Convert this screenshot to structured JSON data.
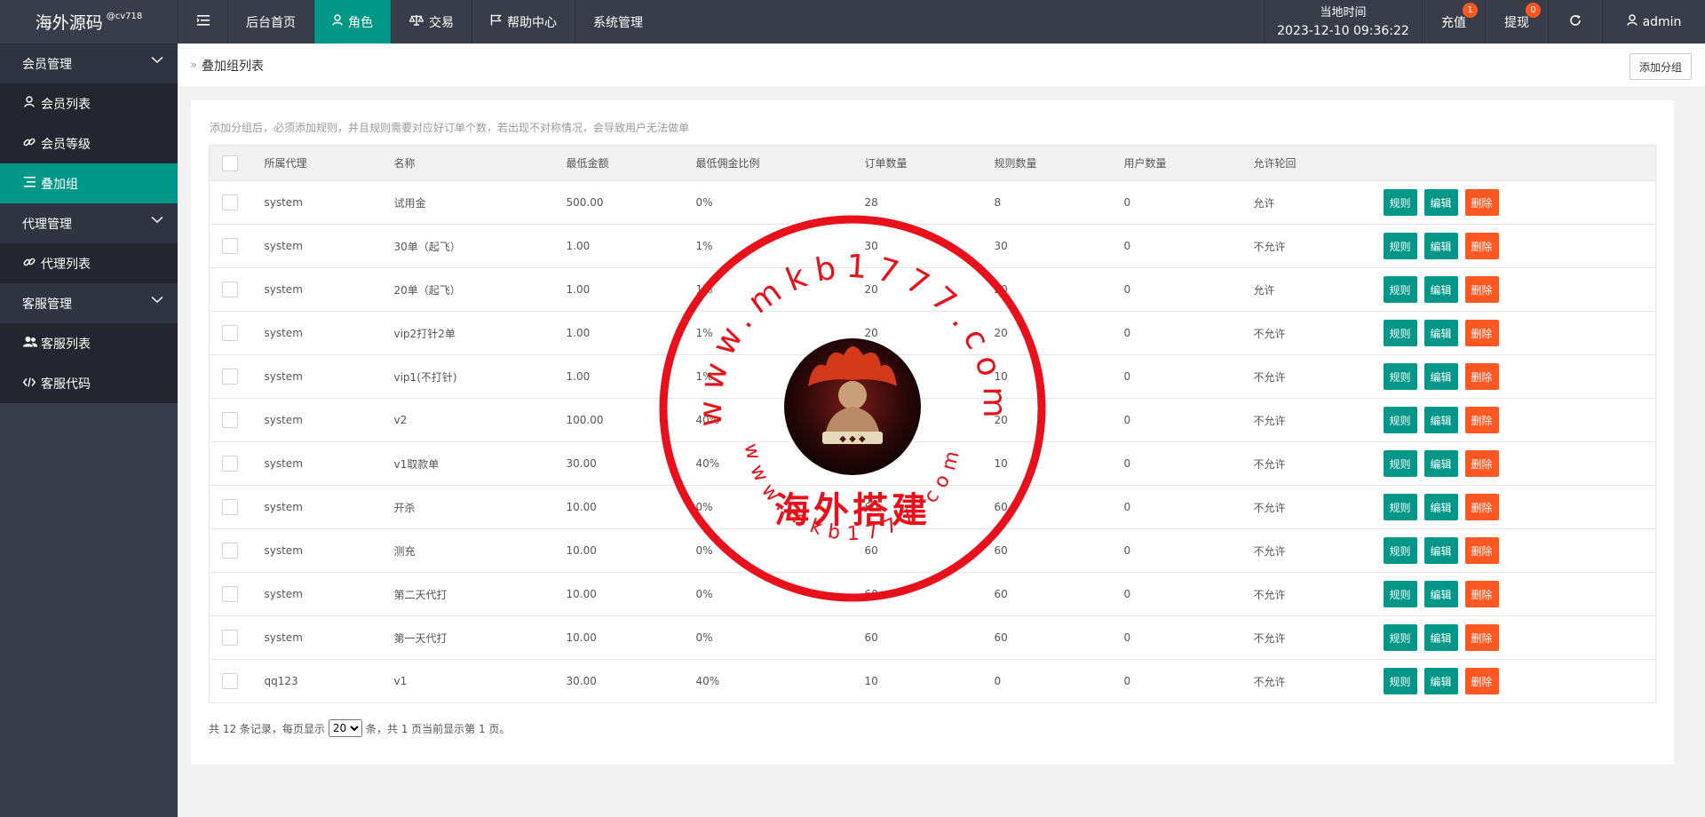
{
  "app": {
    "logo": "海外源码",
    "logo_sup": "@cv718"
  },
  "nav": [
    {
      "label": "后台首页",
      "icon": "",
      "active": false
    },
    {
      "label": "角色",
      "icon": "user-icon",
      "active": true
    },
    {
      "label": "交易",
      "icon": "scale-icon",
      "active": false
    },
    {
      "label": "帮助中心",
      "icon": "flag-icon",
      "active": false
    },
    {
      "label": "系统管理",
      "icon": "",
      "active": false
    }
  ],
  "header_right": {
    "time_label": "当地时间",
    "time_value": "2023-12-10 09:36:22",
    "recharge_label": "充值",
    "recharge_badge": "1",
    "withdraw_label": "提现",
    "withdraw_badge": "0",
    "refresh_icon": "refresh-icon",
    "user_label": "admin"
  },
  "sidebar": [
    {
      "type": "group",
      "label": "会员管理"
    },
    {
      "type": "item",
      "label": "会员列表",
      "icon": "user-icon"
    },
    {
      "type": "item",
      "label": "会员等级",
      "icon": "link-icon"
    },
    {
      "type": "item",
      "label": "叠加组",
      "icon": "list-icon",
      "active": true
    },
    {
      "type": "group",
      "label": "代理管理"
    },
    {
      "type": "item",
      "label": "代理列表",
      "icon": "link-icon"
    },
    {
      "type": "group",
      "label": "客服管理"
    },
    {
      "type": "item",
      "label": "客服列表",
      "icon": "users-icon"
    },
    {
      "type": "item",
      "label": "客服代码",
      "icon": "code-icon"
    }
  ],
  "breadcrumb": {
    "sep": "»",
    "title": "叠加组列表"
  },
  "add_group_label": "添加分组",
  "tip": "添加分组后，必须添加规则，并且规则需要对应好订单个数，若出现不对称情况，会导致用户无法做单",
  "table": {
    "headers": [
      "所属代理",
      "名称",
      "最低金额",
      "最低佣金比例",
      "订单数量",
      "规则数量",
      "用户数量",
      "允许轮回"
    ],
    "rows": [
      [
        "system",
        "试用金",
        "500.00",
        "0%",
        "28",
        "8",
        "0",
        "允许"
      ],
      [
        "system",
        "30单（起飞）",
        "1.00",
        "1%",
        "30",
        "30",
        "0",
        "不允许"
      ],
      [
        "system",
        "20单（起飞）",
        "1.00",
        "1%",
        "20",
        "20",
        "0",
        "允许"
      ],
      [
        "system",
        "vip2打针2单",
        "1.00",
        "1%",
        "20",
        "20",
        "0",
        "不允许"
      ],
      [
        "system",
        "vip1(不打针)",
        "1.00",
        "1%",
        "10",
        "10",
        "0",
        "不允许"
      ],
      [
        "system",
        "v2",
        "100.00",
        "40%",
        "20",
        "20",
        "0",
        "不允许"
      ],
      [
        "system",
        "v1取款单",
        "30.00",
        "40%",
        "10",
        "10",
        "0",
        "不允许"
      ],
      [
        "system",
        "开杀",
        "10.00",
        "0%",
        "60",
        "60",
        "0",
        "不允许"
      ],
      [
        "system",
        "测充",
        "10.00",
        "0%",
        "60",
        "60",
        "0",
        "不允许"
      ],
      [
        "system",
        "第二天代打",
        "10.00",
        "0%",
        "60",
        "60",
        "0",
        "不允许"
      ],
      [
        "system",
        "第一天代打",
        "10.00",
        "0%",
        "60",
        "60",
        "0",
        "不允许"
      ],
      [
        "qq123",
        "v1",
        "30.00",
        "40%",
        "10",
        "0",
        "0",
        "不允许"
      ]
    ],
    "actions": {
      "rule": "规则",
      "edit": "编辑",
      "delete": "删除"
    }
  },
  "pager": {
    "prefix": "共 12 条记录，每页显示",
    "page_size": "20",
    "suffix": "条，共 1 页当前显示第 1 页。"
  },
  "watermark": {
    "top_text": "www.mkb1777.com",
    "center_text": "海外搭建",
    "bottom_text": "www.mkb1777.com"
  },
  "colors": {
    "header_bg": "#393d49",
    "accent": "#009688",
    "danger": "#ff5722",
    "stamp_red": "#e8101a"
  }
}
